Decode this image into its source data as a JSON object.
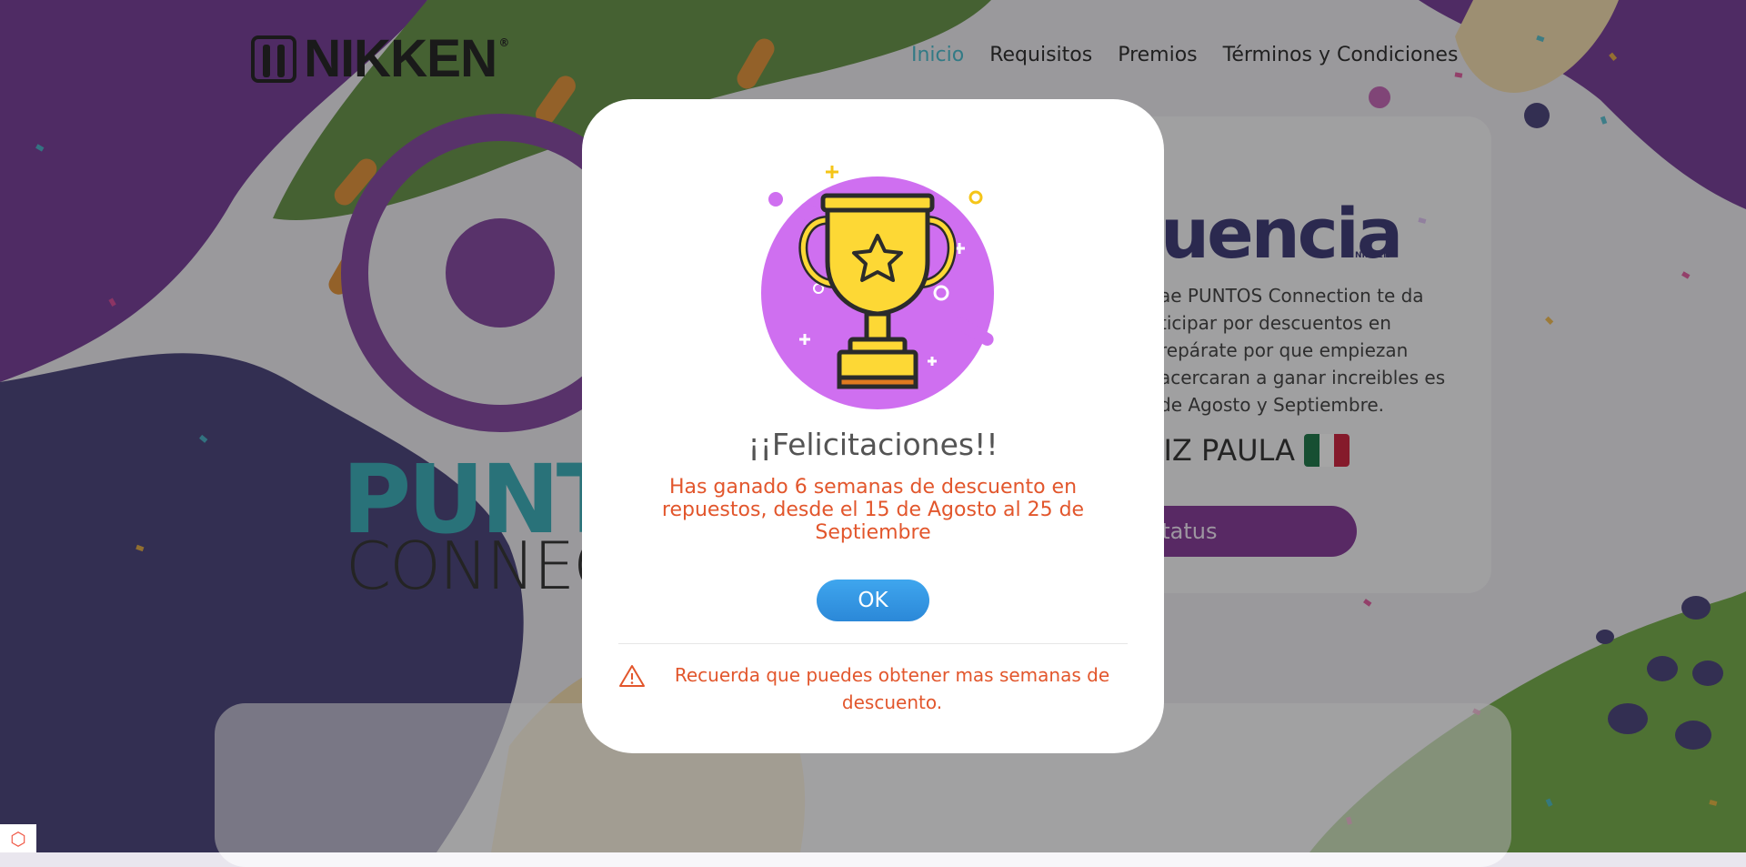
{
  "brand": {
    "name": "NIKKEN",
    "registered": "®"
  },
  "nav": [
    {
      "label": "Inicio",
      "active": true
    },
    {
      "label": "Requisitos"
    },
    {
      "label": "Premios"
    },
    {
      "label": "Términos y Condiciones"
    }
  ],
  "background": {
    "puntos_logo": "PUNT",
    "connect_logo": "CONNEC",
    "side_brand": "uencia",
    "side_brand_sub": "NIKKEN",
    "side_text": "ae PUNTOS Connection te da ticipar por descuentos en repárate por que empiezan acercaran a ganar increibles es de Agosto y Septiembre.",
    "user_name": "RTIZ PAULA",
    "status_button": "estatus"
  },
  "modal": {
    "title": "¡¡Felicitaciones!!",
    "message": "Has ganado 6 semanas de descuento en repuestos, desde el 15 de Agosto al 25 de Septiembre",
    "ok_label": "OK",
    "footer": "Recuerda que puedes obtener mas semanas de descuento."
  },
  "colors": {
    "nav_active": "#3ab6c9",
    "accent_text": "#e2562c",
    "ok_button": "#3498e8",
    "trophy_circle": "#cf6ff0",
    "trophy_gold": "#fdd835"
  },
  "icons": {
    "warning": "warning-icon",
    "trophy": "trophy-icon",
    "laravel": "laravel-icon"
  }
}
